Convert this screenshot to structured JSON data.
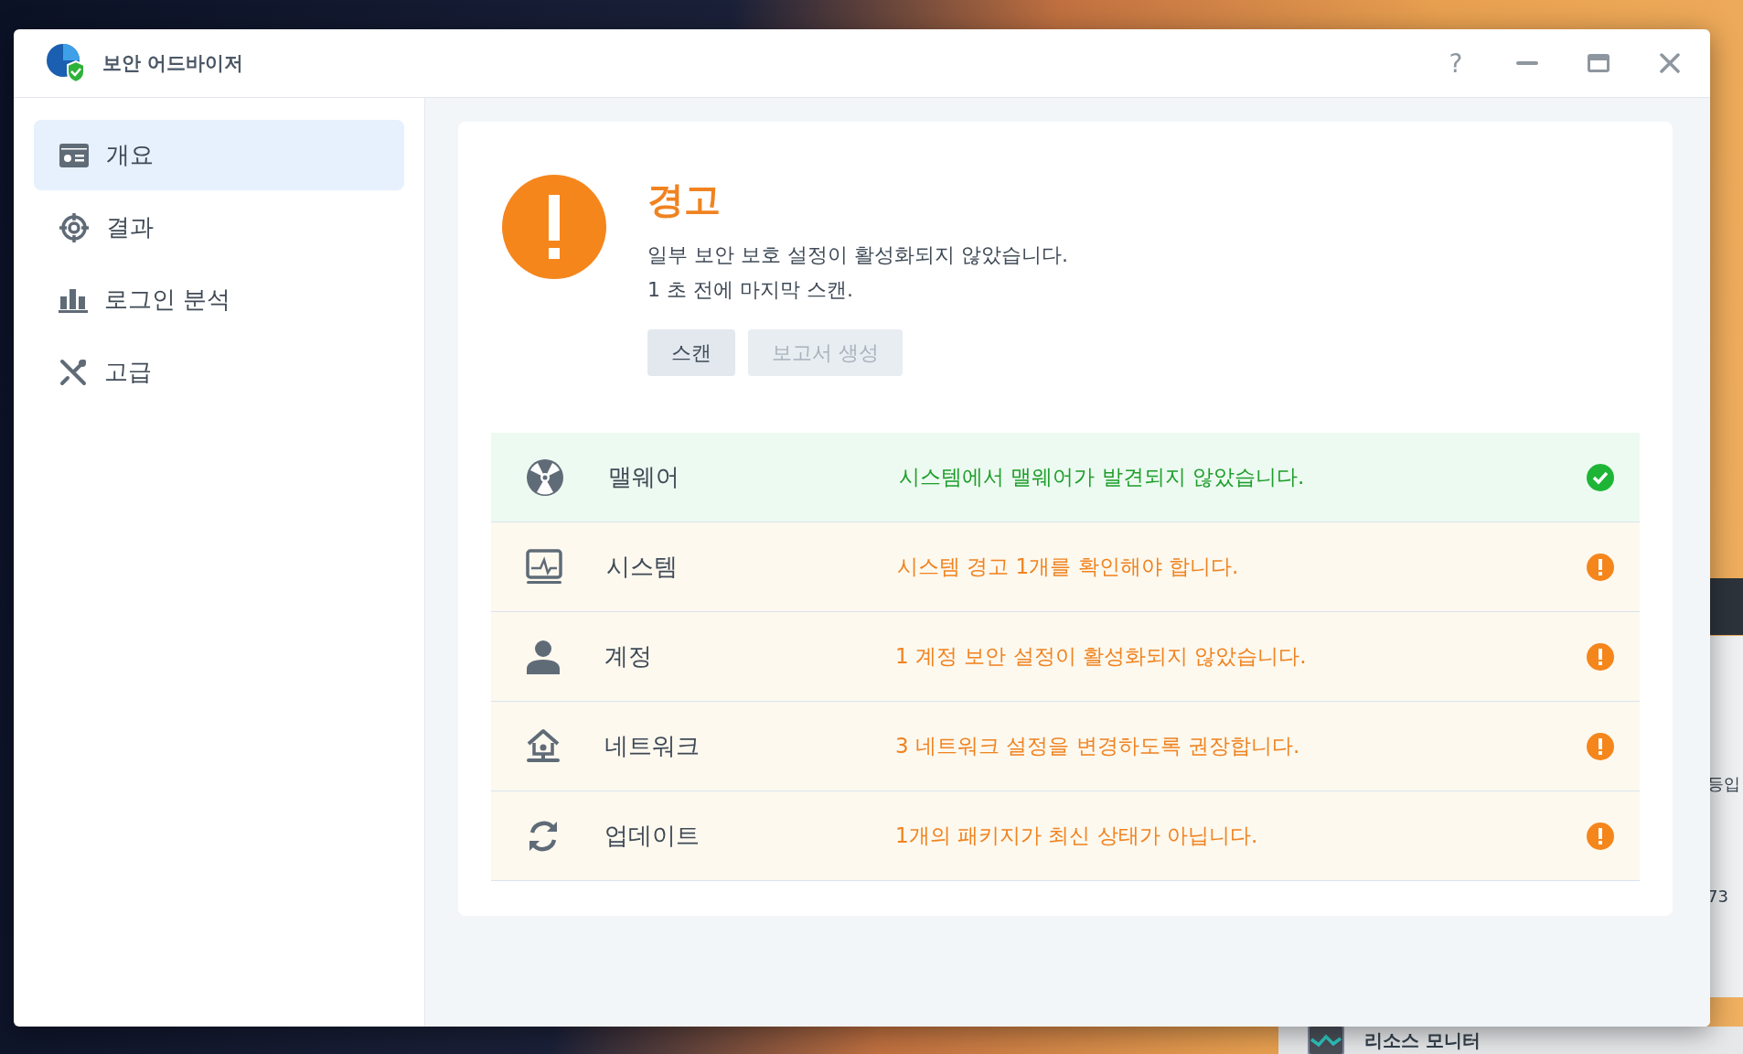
{
  "window": {
    "title": "보안 어드바이저",
    "help_glyph": "?"
  },
  "sidebar": {
    "items": [
      {
        "label": "개요",
        "selected": true
      },
      {
        "label": "결과",
        "selected": false
      },
      {
        "label": "로그인 분석",
        "selected": false
      },
      {
        "label": "고급",
        "selected": false
      }
    ]
  },
  "overview": {
    "title": "경고",
    "lines": [
      "일부 보안 보호 설정이 활성화되지 않았습니다.",
      "1 초 전에 마지막 스캔."
    ],
    "buttons": [
      {
        "label": "스캔",
        "disabled": false
      },
      {
        "label": "보고서 생성",
        "disabled": true
      }
    ]
  },
  "categories": [
    {
      "label": "맬웨어",
      "message": "시스템에서 맬웨어가 발견되지 않았습니다.",
      "kind": "ok"
    },
    {
      "label": "시스템",
      "message": "시스템 경고 1개를 확인해야 합니다.",
      "kind": "warning"
    },
    {
      "label": "계정",
      "message": "1 계정 보안 설정이 활성화되지 않았습니다.",
      "kind": "warning"
    },
    {
      "label": "네트워크",
      "message": "3 네트워크 설정을 변경하도록 권장합니다.",
      "kind": "warning"
    },
    {
      "label": "업데이트",
      "message": "1개의 패키지가 최신 상태가 아닙니다.",
      "kind": "warning"
    }
  ],
  "background": {
    "texts": [
      "등입",
      "73"
    ],
    "taskbar_item": "리소스 모니터"
  }
}
